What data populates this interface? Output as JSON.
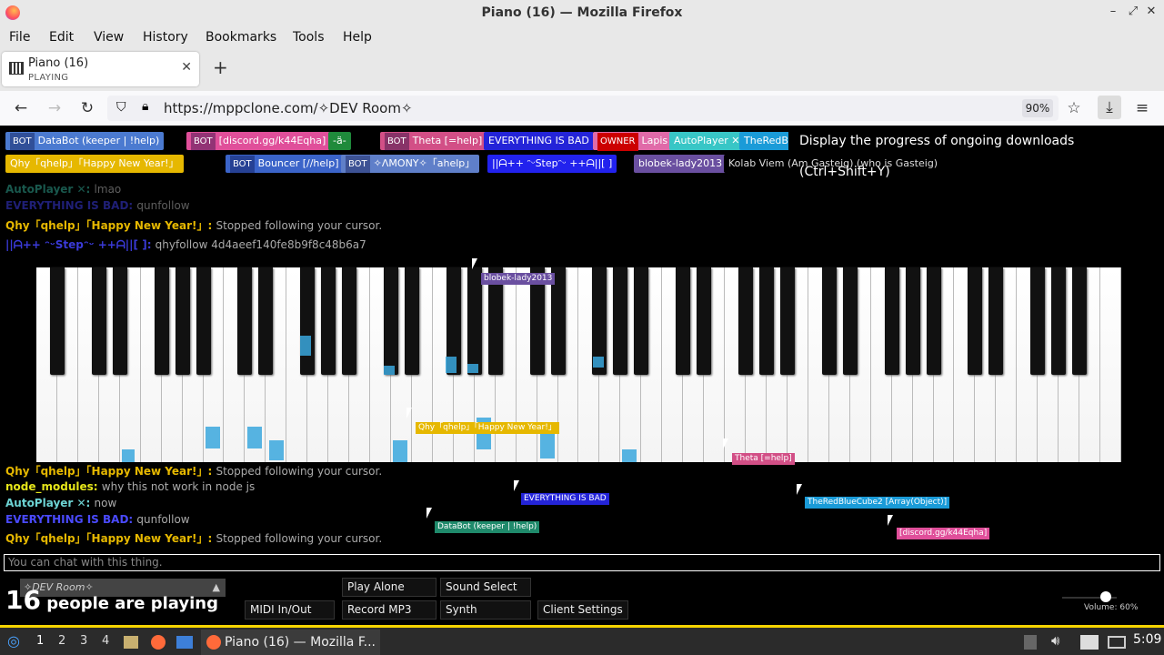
{
  "window": {
    "title": "Piano (16) — Mozilla Firefox"
  },
  "menubar": {
    "items": [
      "File",
      "Edit",
      "View",
      "History",
      "Bookmarks",
      "Tools",
      "Help"
    ]
  },
  "tab": {
    "title": "Piano (16)",
    "subtitle": "PLAYING",
    "close": "✕",
    "new": "+"
  },
  "nav": {
    "url": "https://mppclone.com/✧DEV Room✧",
    "zoom": "90%",
    "back": "←",
    "forward": "→",
    "reload": "↻"
  },
  "tooltip": "Display the progress of ongoing downloads (Ctrl+Shift+Y)",
  "users_row1": [
    {
      "bot": "BOT",
      "name": "DataBot (keeper | !help)",
      "color": "#4b7ad0"
    },
    {
      "bot": "BOT",
      "name": "[discord.gg/k44Eqha]",
      "color": "#e04f9a"
    },
    {
      "bot": "",
      "name": "-ä-",
      "color": "#1f8a3b"
    },
    {
      "bot": "BOT",
      "name": "Theta [=help]",
      "color": "#d24f86"
    },
    {
      "bot": "",
      "name": "EVERYTHING IS BAD",
      "color": "#2424d8"
    },
    {
      "bot": "OWNER",
      "name": "Lapis",
      "color": "#e06aa8"
    },
    {
      "bot": "",
      "name": "AutoPlayer ✕",
      "color": "#38c6c6"
    },
    {
      "bot": "",
      "name": "TheRedB",
      "color": "#1a9bd8"
    }
  ],
  "users_row2": [
    {
      "bot": "",
      "name": "Qhy「qhelp」「Happy New Year!」",
      "color": "#e6b800"
    },
    {
      "bot": "BOT",
      "name": "Bouncer [//help]",
      "color": "#3b64c9"
    },
    {
      "bot": "BOT",
      "name": "✧ΛΜΟΝΥ✧「ahelp」",
      "color": "#5f7fc9"
    },
    {
      "bot": "",
      "name": "||ᗩ++ ᵔᵕStepᵔᵕ ++ᗩ||[ ]",
      "color": "#2222ee"
    },
    {
      "bot": "",
      "name": "blobek-lady2013",
      "color": "#6a4fa0"
    },
    {
      "bot": "",
      "name": "Kolab Viem (Am Gasteig) (who is Gasteig)",
      "color": "#000000"
    }
  ],
  "chat_top": [
    {
      "name": "AutoPlayer ✕:",
      "msg": "lmao",
      "color": "#2fa08d"
    },
    {
      "name": "EVERYTHING IS BAD:",
      "msg": "qunfollow",
      "color": "#3a3ad8"
    },
    {
      "name": "Qhy「qhelp」「Happy New Year!」:",
      "msg": "Stopped following your cursor.",
      "color": "#e6b800"
    },
    {
      "name": "||ᗩ++ ᵔᵕStepᵔᵕ ++ᗩ||[ ]:",
      "msg": "qhyfollow 4d4aeef140fe8b9f8c48b6a7",
      "color": "#3a3ad8"
    }
  ],
  "chat_bottom": [
    {
      "name": "Qhy「qhelp」「Happy New Year!」:",
      "msg": "Stopped following your cursor.",
      "color": "#e6b800"
    },
    {
      "name": "node_modules:",
      "msg": "why this not work in node js",
      "color": "#e6e61a"
    },
    {
      "name": "AutoPlayer ✕:",
      "msg": "now",
      "color": "#6dd4d4"
    },
    {
      "name": "EVERYTHING IS BAD:",
      "msg": "qunfollow",
      "color": "#4a4aff"
    },
    {
      "name": "Qhy「qhelp」「Happy New Year!」:",
      "msg": "Stopped following your cursor.",
      "color": "#e6b800"
    }
  ],
  "cursors": [
    {
      "label": "blobek-lady2013",
      "color": "#6a4fa0"
    },
    {
      "label": "Qhy「qhelp」「Happy New Year!」",
      "color": "#e6b800"
    },
    {
      "label": "Theta [=help]",
      "color": "#d24f86"
    },
    {
      "label": "EVERYTHING IS BAD",
      "color": "#2424d8"
    },
    {
      "label": "TheRedBlueCube2 [Array(Object)]",
      "color": "#1a9bd8"
    },
    {
      "label": "DataBot (keeper | !help)",
      "color": "#1f8a6b"
    },
    {
      "label": "[discord.gg/k44Eqha]",
      "color": "#e04f9a"
    }
  ],
  "chat_input": {
    "placeholder": "You can chat with this thing."
  },
  "room": "✧DEV Room✧",
  "people": {
    "count": "16",
    "text": "people are playing"
  },
  "buttons": {
    "play_alone": "Play Alone",
    "sound_select": "Sound Select",
    "midi": "MIDI In/Out",
    "record": "Record MP3",
    "synth": "Synth",
    "client_settings": "Client Settings"
  },
  "volume": "Volume: 60%",
  "taskbar": {
    "ws": [
      "1",
      "2",
      "3",
      "4"
    ],
    "task": "Piano (16) — Mozilla F...",
    "clock": "5:09"
  }
}
